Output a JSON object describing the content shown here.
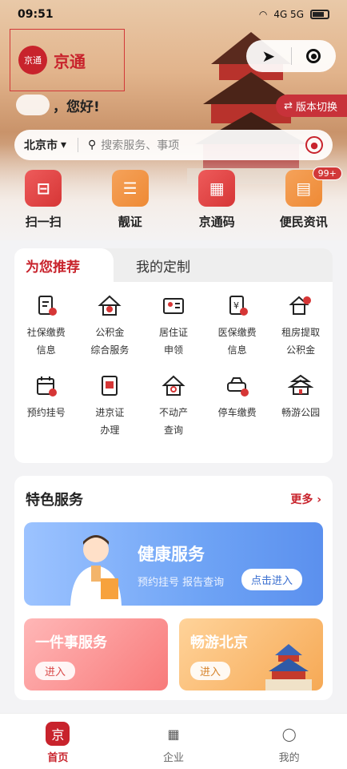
{
  "status_bar": {
    "time": "09:51",
    "network": "4G 5G"
  },
  "brand": {
    "logo_text": "京通",
    "name": "京通"
  },
  "greeting": "，您好!",
  "version_button": "版本切换",
  "search": {
    "city": "北京市",
    "placeholder": "搜索服务、事项"
  },
  "quick_actions": [
    {
      "label": "扫一扫",
      "icon": "scan-icon"
    },
    {
      "label": "靓证",
      "icon": "id-card-icon"
    },
    {
      "label": "京通码",
      "icon": "qr-code-icon"
    },
    {
      "label": "便民资讯",
      "icon": "news-icon",
      "badge": "99+"
    }
  ],
  "recommend": {
    "tab_active": "为您推荐",
    "tab_inactive": "我的定制",
    "items": [
      {
        "l1": "社保缴费",
        "l2": "信息",
        "icon": "social-security-icon"
      },
      {
        "l1": "公积金",
        "l2": "综合服务",
        "icon": "housing-fund-icon"
      },
      {
        "l1": "居住证",
        "l2": "申领",
        "icon": "residence-permit-icon"
      },
      {
        "l1": "医保缴费",
        "l2": "信息",
        "icon": "medical-insurance-icon"
      },
      {
        "l1": "租房提取",
        "l2": "公积金",
        "icon": "rent-withdraw-icon"
      },
      {
        "l1": "预约挂号",
        "l2": "",
        "icon": "appointment-icon"
      },
      {
        "l1": "进京证",
        "l2": "办理",
        "icon": "beijing-permit-icon"
      },
      {
        "l1": "不动产",
        "l2": "查询",
        "icon": "real-estate-icon"
      },
      {
        "l1": "停车缴费",
        "l2": "",
        "icon": "parking-icon"
      },
      {
        "l1": "畅游公园",
        "l2": "",
        "icon": "park-icon"
      }
    ]
  },
  "featured": {
    "title": "特色服务",
    "more": "更多 ›",
    "health": {
      "title": "健康服务",
      "subtitle": "预约挂号 报告查询",
      "button": "点击进入"
    },
    "tile_left": {
      "title": "一件事服务",
      "button": "进入"
    },
    "tile_right": {
      "title": "畅游北京",
      "button": "进入"
    }
  },
  "tabbar": [
    {
      "label": "首页",
      "icon": "home-icon",
      "glyph": "京",
      "active": true
    },
    {
      "label": "企业",
      "icon": "enterprise-icon",
      "glyph": "▦",
      "active": false
    },
    {
      "label": "我的",
      "icon": "profile-icon",
      "glyph": "◯",
      "active": false
    }
  ],
  "colors": {
    "brand_red": "#c8232c",
    "accent_orange": "#ee8a35",
    "health_blue": "#6ea3f5"
  }
}
